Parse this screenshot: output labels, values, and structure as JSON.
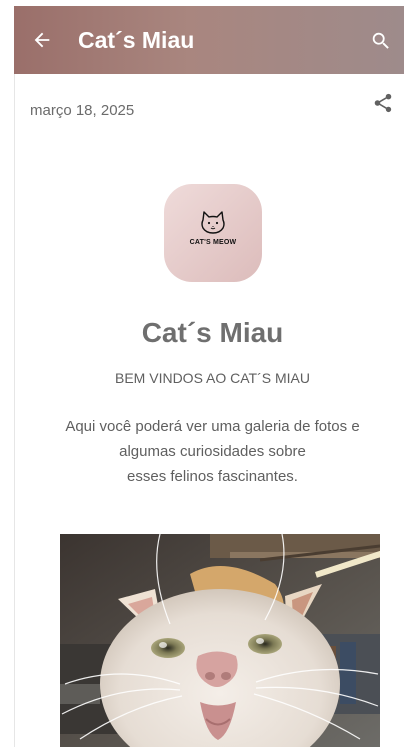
{
  "header": {
    "title": "Cat´s Miau",
    "back_icon": "arrow-left-icon",
    "search_icon": "search-icon"
  },
  "post": {
    "date": "março 18, 2025",
    "share_icon": "share-icon"
  },
  "logo": {
    "text": "CAT'S MEOW",
    "icon": "cat-face-icon"
  },
  "content": {
    "title": "Cat´s Miau",
    "subtitle": "BEM VINDOS AO CAT´S MIAU",
    "description": [
      "Aqui você poderá ver uma galeria de fotos e",
      "algumas curiosidades sobre",
      "esses felinos fascinantes."
    ]
  },
  "colors": {
    "header_start": "#9a6f6a",
    "header_end": "#9e8b8b",
    "text_gray": "#6f6f6f"
  }
}
